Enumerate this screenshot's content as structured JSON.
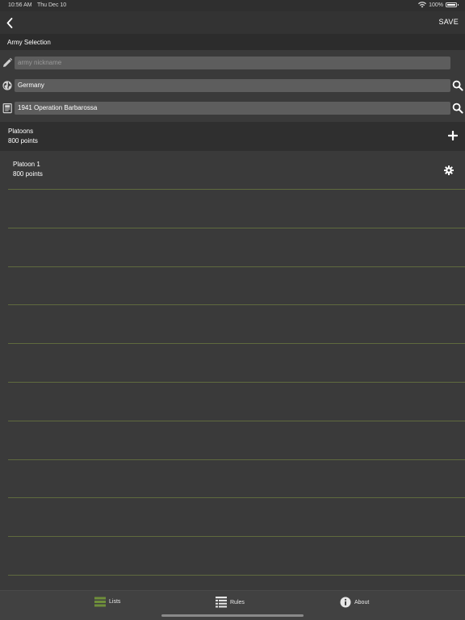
{
  "status_bar": {
    "time": "10:56 AM",
    "date": "Thu Dec 10",
    "battery_text": "100%",
    "battery_level": 1.0
  },
  "nav": {
    "back_icon": "chevron-left-icon",
    "save_label": "SAVE"
  },
  "army_section": {
    "title": "Army Selection",
    "nickname": {
      "placeholder": "army nickname",
      "value": "",
      "icon": "pencil-icon"
    },
    "nation": {
      "value": "Germany",
      "icon": "globe-icon"
    },
    "book": {
      "value": "1941 Operation Barbarossa",
      "icon": "book-icon"
    }
  },
  "platoons_section": {
    "title": "Platoons",
    "points": "800 points",
    "add_icon": "plus-icon"
  },
  "platoons": [
    {
      "name": "Platoon 1",
      "points": "800 points"
    }
  ],
  "tabs": [
    {
      "label": "Lists",
      "icon": "lists-icon"
    },
    {
      "label": "Rules",
      "icon": "rules-icon"
    },
    {
      "label": "About",
      "icon": "info-icon"
    }
  ],
  "colors": {
    "background": "#3a3a3a",
    "field": "#5d5d5d",
    "divider": "#5f6a3e",
    "lists_accent": "#6f8f3a"
  }
}
